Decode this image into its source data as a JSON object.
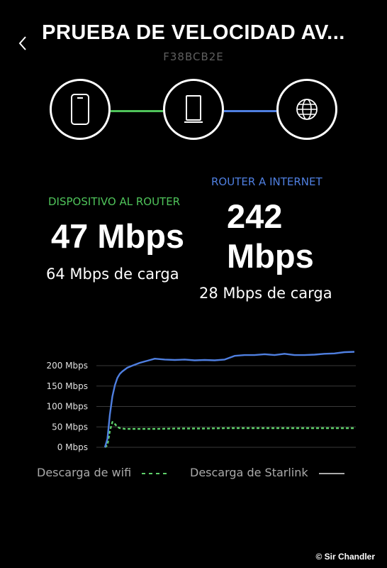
{
  "header": {
    "title": "PRUEBA DE VELOCIDAD AV...",
    "subtitle": "F38BCB2E"
  },
  "diagram": {
    "nodes": [
      "phone-icon",
      "router-icon",
      "globe-icon"
    ],
    "link_colors": [
      "#4fc35a",
      "#4f7fe0"
    ]
  },
  "device_to_router": {
    "label": "DISPOSITIVO AL ROUTER",
    "label_color": "#4fc35a",
    "speed": "47 Mbps",
    "upload": "64 Mbps de carga"
  },
  "router_to_internet": {
    "label": "ROUTER A INTERNET",
    "label_color": "#4f7fe0",
    "speed_line1": "242",
    "speed_line2": "Mbps",
    "upload": "28 Mbps de carga"
  },
  "chart_data": {
    "type": "line",
    "ylim": [
      0,
      230
    ],
    "yticks": [
      "0 Mbps",
      "50 Mbps",
      "100 Mbps",
      "150 Mbps",
      "200 Mbps"
    ],
    "ytick_values": [
      0,
      50,
      100,
      150,
      200
    ],
    "grid": true,
    "legend_position": "bottom",
    "series": [
      {
        "name": "Descarga de wifi",
        "style": "dashed",
        "color": "#5ed06a",
        "x": [
          0,
          1,
          2,
          3,
          4,
          5,
          6,
          8,
          10,
          15,
          20,
          30,
          40,
          50,
          60,
          70,
          80,
          90,
          100
        ],
        "values": [
          0,
          5,
          40,
          62,
          57,
          50,
          47,
          45,
          45,
          45,
          45,
          46,
          46,
          47,
          47,
          47,
          47,
          47,
          47
        ]
      },
      {
        "name": "Descarga de Starlink",
        "style": "solid",
        "color": "#4f7fe0",
        "x": [
          0,
          1,
          2,
          3,
          4,
          5,
          6,
          7,
          9,
          11,
          14,
          17,
          20,
          24,
          28,
          32,
          36,
          40,
          44,
          48,
          52,
          56,
          60,
          64,
          68,
          72,
          76,
          80,
          84,
          88,
          92,
          96,
          100
        ],
        "values": [
          0,
          20,
          80,
          125,
          152,
          170,
          180,
          186,
          195,
          200,
          207,
          212,
          217,
          215,
          214,
          215,
          213,
          214,
          213,
          215,
          224,
          226,
          226,
          228,
          226,
          229,
          226,
          226,
          227,
          229,
          230,
          233,
          234
        ]
      }
    ]
  },
  "credit": "© Sir Chandler"
}
